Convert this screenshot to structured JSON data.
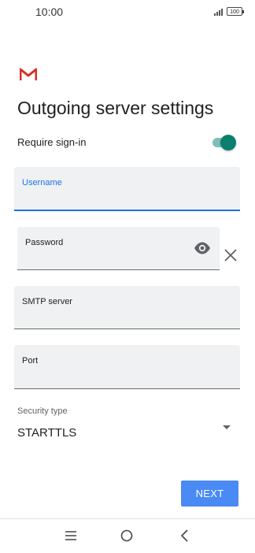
{
  "status_bar": {
    "time": "10:00",
    "battery": "100"
  },
  "title": "Outgoing server settings",
  "require_signin": {
    "label": "Require sign-in",
    "enabled": true
  },
  "fields": {
    "username": {
      "label": "Username",
      "value": ""
    },
    "password": {
      "label": "Password",
      "value": ""
    },
    "smtp_server": {
      "label": "SMTP server",
      "value": ""
    },
    "port": {
      "label": "Port",
      "value": ""
    }
  },
  "security": {
    "label": "Security type",
    "value": "STARTTLS"
  },
  "next_button": {
    "label": "NEXT"
  },
  "colors": {
    "accent": "#1a73e8",
    "button": "#4a8af4",
    "toggle": "#0b7f6e"
  },
  "icons": [
    "signal-icon",
    "battery-icon",
    "gmail-logo",
    "eye-icon",
    "close-icon",
    "dropdown-arrow-icon",
    "menu-icon",
    "home-icon",
    "back-icon"
  ]
}
